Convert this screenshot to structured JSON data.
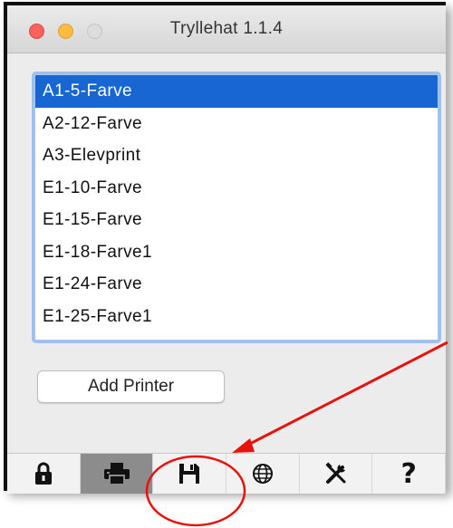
{
  "window": {
    "title": "Tryllehat 1.1.4"
  },
  "printers": {
    "items": [
      {
        "label": "A1-5-Farve",
        "selected": true
      },
      {
        "label": "A2-12-Farve",
        "selected": false
      },
      {
        "label": "A3-Elevprint",
        "selected": false
      },
      {
        "label": "E1-10-Farve",
        "selected": false
      },
      {
        "label": "E1-15-Farve",
        "selected": false
      },
      {
        "label": "E1-18-Farve1",
        "selected": false
      },
      {
        "label": "E1-24-Farve",
        "selected": false
      },
      {
        "label": "E1-25-Farve1",
        "selected": false
      }
    ]
  },
  "buttons": {
    "add_printer": "Add Printer"
  },
  "toolbar": {
    "tabs": [
      {
        "icon": "lock-icon",
        "active": false
      },
      {
        "icon": "printer-icon",
        "active": true
      },
      {
        "icon": "save-icon",
        "active": false
      },
      {
        "icon": "globe-icon",
        "active": false
      },
      {
        "icon": "tools-icon",
        "active": false
      },
      {
        "icon": "help-icon",
        "label": "?",
        "active": false
      }
    ]
  },
  "annotation": {
    "arrow_color": "#e8120c",
    "circle_color": "#e8120c"
  }
}
